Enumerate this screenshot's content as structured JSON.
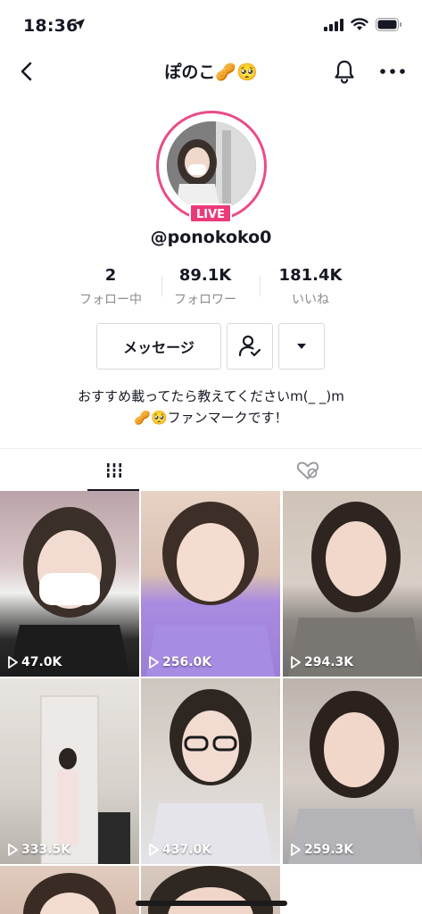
{
  "status": {
    "time": "18:36"
  },
  "nav": {
    "title": "ぽのこ🥜🥺"
  },
  "profile": {
    "live_label": "LIVE",
    "username": "@ponokoko0"
  },
  "stats": [
    {
      "value": "2",
      "label": "フォロー中"
    },
    {
      "value": "89.1K",
      "label": "フォロワー"
    },
    {
      "value": "181.4K",
      "label": "いいね"
    }
  ],
  "actions": {
    "message_label": "メッセージ"
  },
  "bio": {
    "line1": "おすすめ載ってたら教えてくださいm(_ _)m",
    "line2": "🥜🥺ファンマークです！"
  },
  "videos": [
    {
      "views": "47.0K"
    },
    {
      "views": "256.0K"
    },
    {
      "views": "294.3K"
    },
    {
      "views": "333.5K"
    },
    {
      "views": "437.0K"
    },
    {
      "views": "259.3K"
    }
  ],
  "icons": {
    "back": "chevron-left-icon",
    "bell": "bell-icon",
    "more": "more-horizontal-icon",
    "friend": "person-check-icon",
    "dropdown": "caret-down-icon",
    "grid": "grid-icon",
    "liked": "heart-hidden-icon",
    "play": "play-icon"
  },
  "colors": {
    "live": "#ea3a7a",
    "ring": "#ea4c89",
    "text": "#161823",
    "muted": "#8a8b91"
  }
}
